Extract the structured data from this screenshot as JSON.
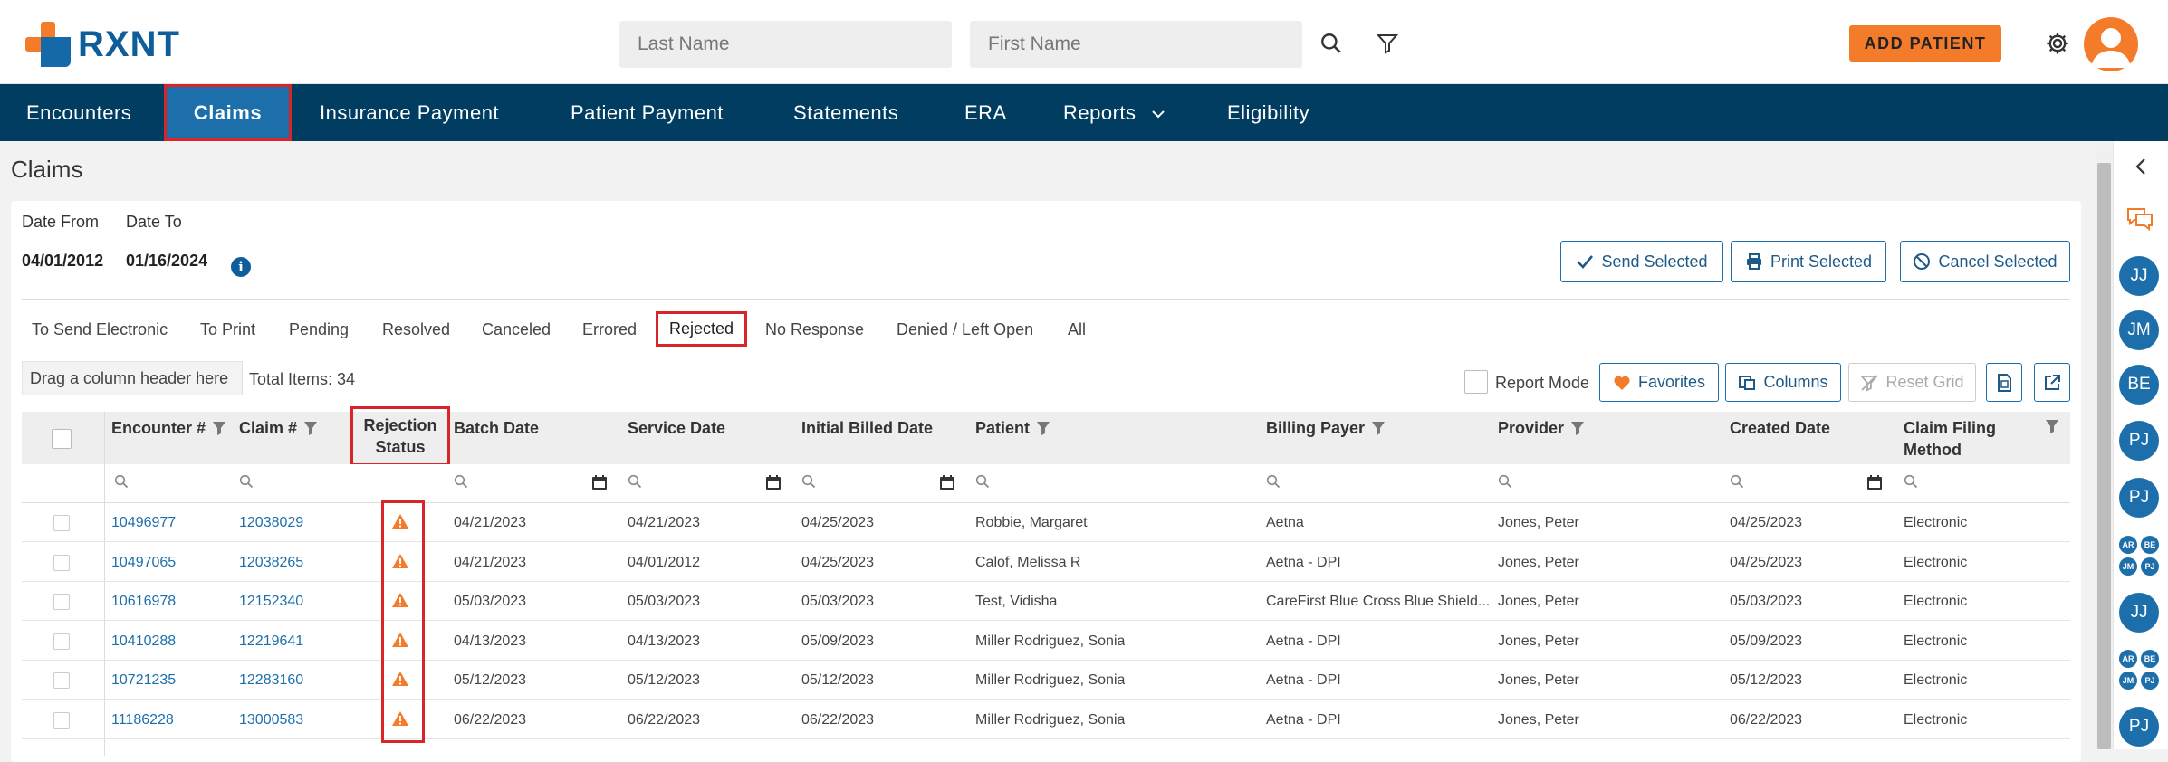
{
  "header": {
    "logo_text": "RXNT",
    "last_name_placeholder": "Last Name",
    "first_name_placeholder": "First Name",
    "add_patient_label": "ADD PATIENT"
  },
  "nav": {
    "items": [
      {
        "label": "Encounters"
      },
      {
        "label": "Claims",
        "active": true
      },
      {
        "label": "Insurance Payment"
      },
      {
        "label": "Patient Payment"
      },
      {
        "label": "Statements"
      },
      {
        "label": "ERA"
      },
      {
        "label": "Reports"
      },
      {
        "label": "Eligibility"
      }
    ]
  },
  "page": {
    "title": "Claims",
    "date_from_label": "Date From",
    "date_to_label": "Date To",
    "date_from_value": "04/01/2012",
    "date_to_value": "01/16/2024",
    "send_selected": "Send Selected",
    "print_selected": "Print Selected",
    "cancel_selected": "Cancel Selected"
  },
  "filter_tabs": [
    {
      "label": "To Send Electronic"
    },
    {
      "label": "To Print"
    },
    {
      "label": "Pending"
    },
    {
      "label": "Resolved"
    },
    {
      "label": "Canceled"
    },
    {
      "label": "Errored"
    },
    {
      "label": "Rejected",
      "active": true
    },
    {
      "label": "No Response"
    },
    {
      "label": "Denied / Left Open"
    },
    {
      "label": "All"
    }
  ],
  "toolbar": {
    "group_hint": "Drag a column header here",
    "total_items": "Total Items: 34",
    "report_mode": "Report Mode",
    "favorites": "Favorites",
    "columns": "Columns",
    "reset_grid": "Reset Grid"
  },
  "grid": {
    "headers": {
      "encounter": "Encounter #",
      "claim": "Claim #",
      "rejection_1": "Rejection",
      "rejection_2": "Status",
      "batch_date": "Batch Date",
      "service_date": "Service Date",
      "initial_billed": "Initial Billed Date",
      "patient": "Patient",
      "billing_payer": "Billing Payer",
      "provider": "Provider",
      "created_date": "Created Date",
      "filing_1": "Claim Filing",
      "filing_2": "Method"
    },
    "rows": [
      {
        "encounter": "10496977",
        "claim": "12038029",
        "batch": "04/21/2023",
        "service": "04/21/2023",
        "initial": "04/25/2023",
        "patient": "Robbie, Margaret",
        "payer": "Aetna",
        "provider": "Jones, Peter",
        "created": "04/25/2023",
        "method": "Electronic"
      },
      {
        "encounter": "10497065",
        "claim": "12038265",
        "batch": "04/21/2023",
        "service": "04/01/2012",
        "initial": "04/25/2023",
        "patient": "Calof, Melissa R",
        "payer": "Aetna - DPI",
        "provider": "Jones, Peter",
        "created": "04/25/2023",
        "method": "Electronic"
      },
      {
        "encounter": "10616978",
        "claim": "12152340",
        "batch": "05/03/2023",
        "service": "05/03/2023",
        "initial": "05/03/2023",
        "patient": "Test, Vidisha",
        "payer": "CareFirst Blue Cross Blue Shield...",
        "provider": "Jones, Peter",
        "created": "05/03/2023",
        "method": "Electronic"
      },
      {
        "encounter": "10410288",
        "claim": "12219641",
        "batch": "04/13/2023",
        "service": "04/13/2023",
        "initial": "05/09/2023",
        "patient": "Miller Rodriguez, Sonia",
        "payer": "Aetna - DPI",
        "provider": "Jones, Peter",
        "created": "05/09/2023",
        "method": "Electronic"
      },
      {
        "encounter": "10721235",
        "claim": "12283160",
        "batch": "05/12/2023",
        "service": "05/12/2023",
        "initial": "05/12/2023",
        "patient": "Miller Rodriguez, Sonia",
        "payer": "Aetna - DPI",
        "provider": "Jones, Peter",
        "created": "05/12/2023",
        "method": "Electronic"
      },
      {
        "encounter": "11186228",
        "claim": "13000583",
        "batch": "06/22/2023",
        "service": "06/22/2023",
        "initial": "06/22/2023",
        "patient": "Miller Rodriguez, Sonia",
        "payer": "Aetna - DPI",
        "provider": "Jones, Peter",
        "created": "06/22/2023",
        "method": "Electronic"
      }
    ]
  },
  "rail": {
    "badges": [
      "JJ",
      "JM",
      "BE",
      "PJ",
      "PJ",
      "JJ",
      "PJ"
    ],
    "mini_groups": [
      [
        "AR",
        "BE",
        "JM",
        "PJ"
      ],
      [
        "AR",
        "BE",
        "JM",
        "PJ"
      ]
    ]
  },
  "colors": {
    "nav_bg": "#003d60",
    "accent_orange": "#f47b2a",
    "link_blue": "#1d6fab",
    "highlight_red": "#d9242a"
  }
}
